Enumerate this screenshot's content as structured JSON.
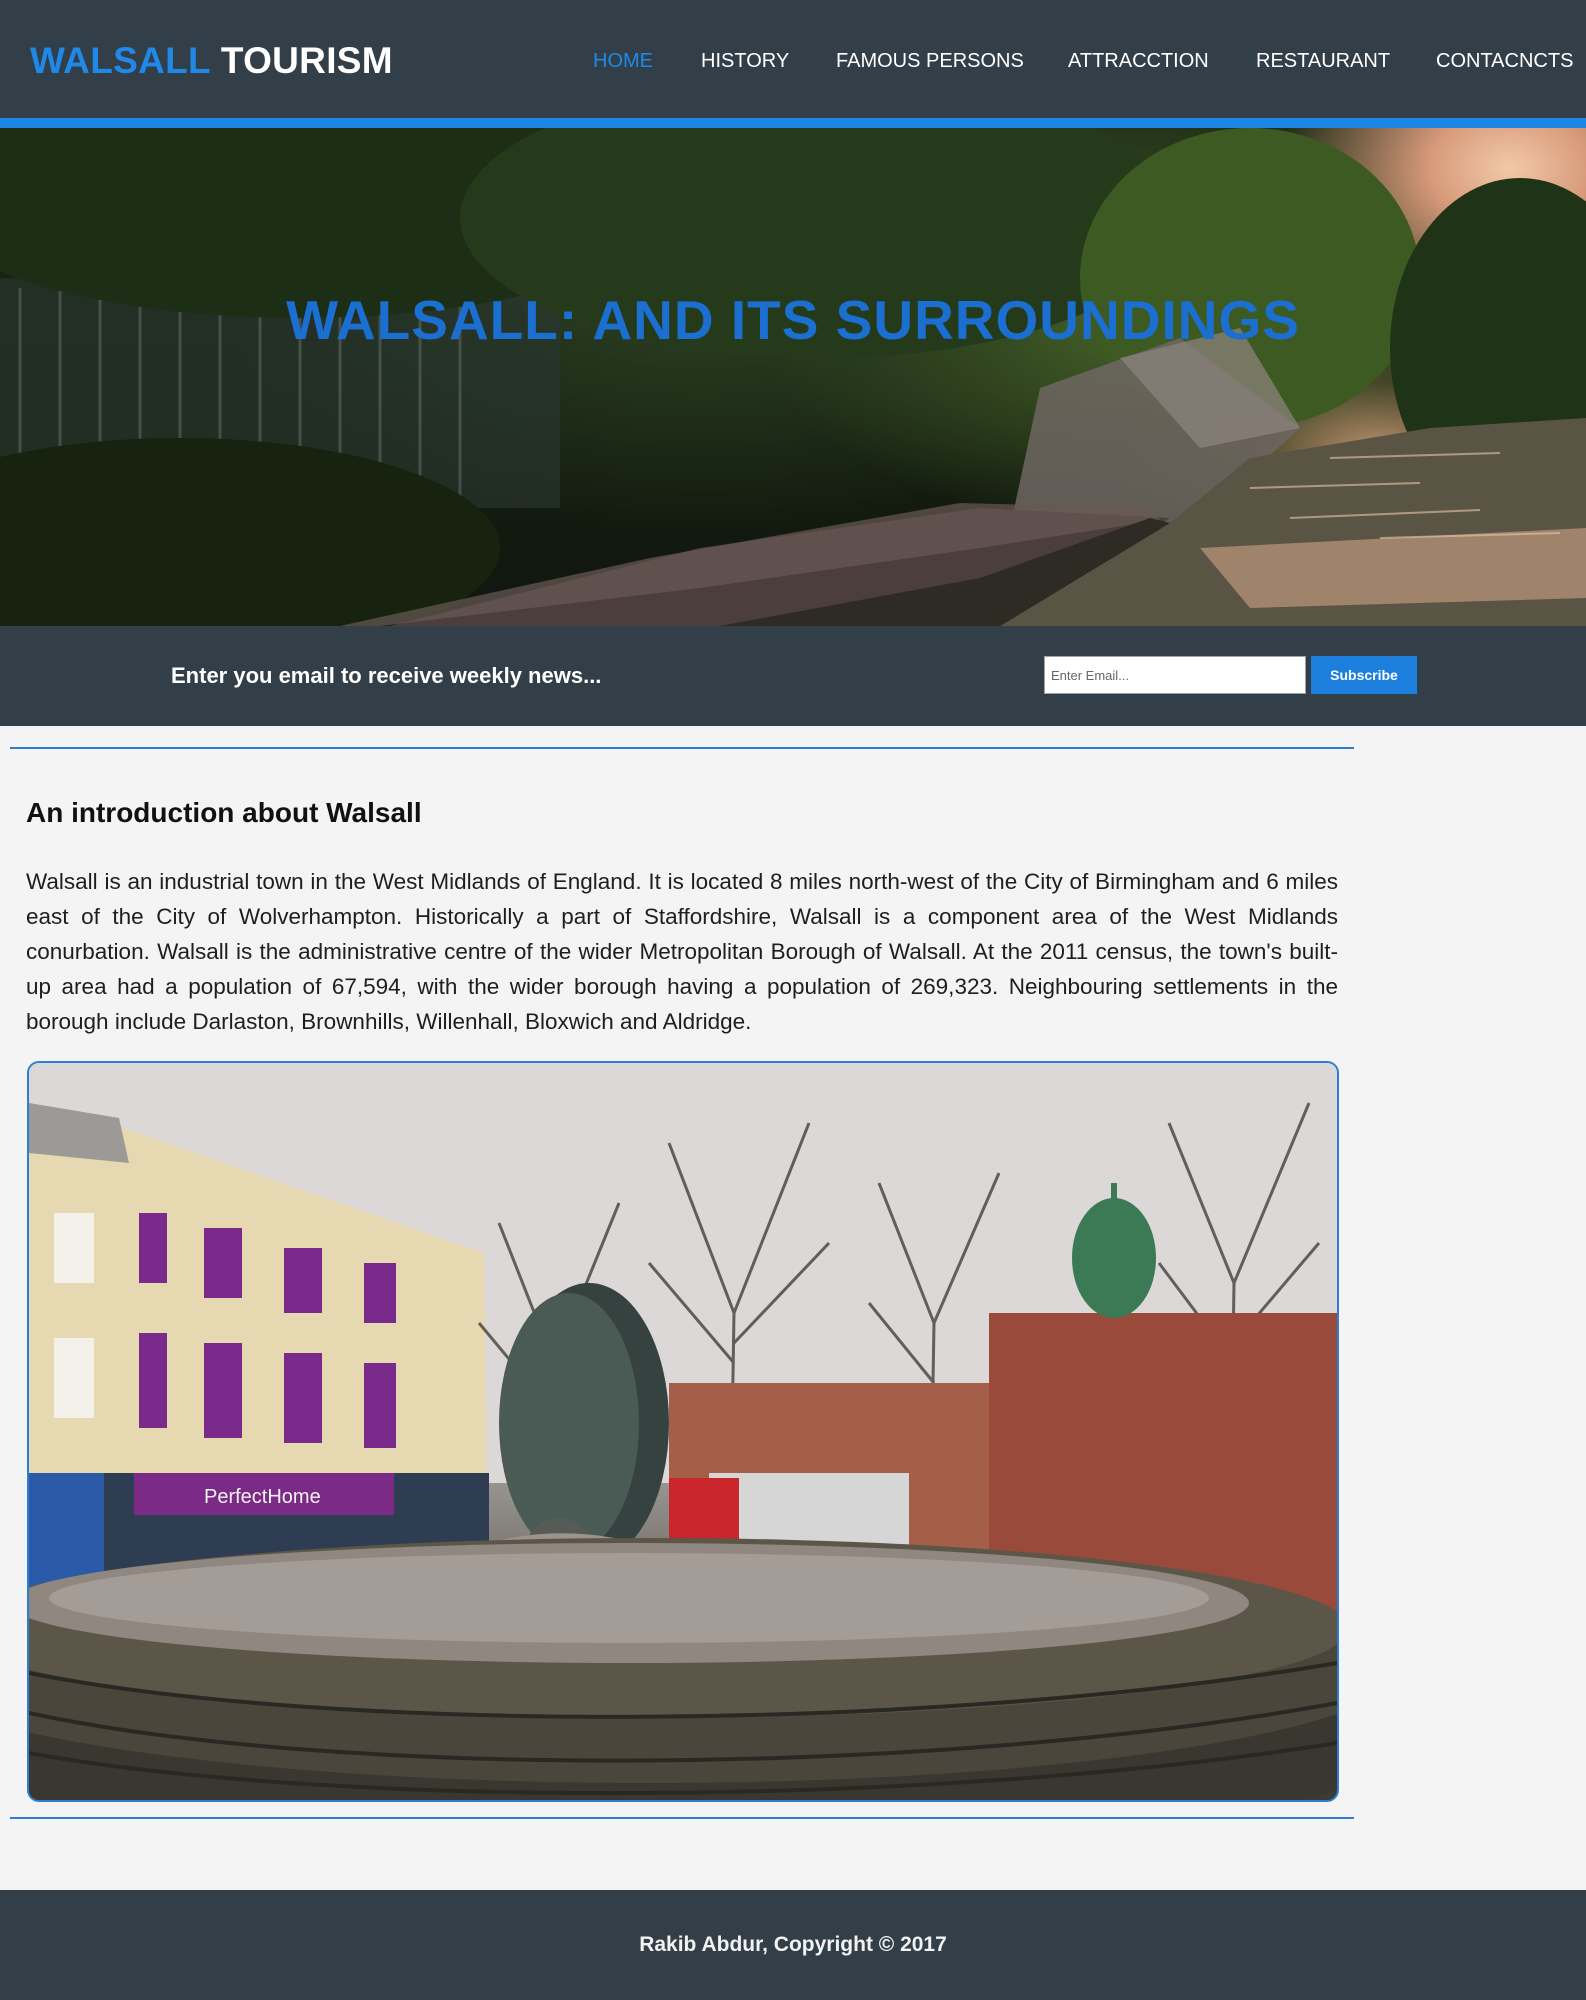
{
  "header": {
    "logo_accent": "WALSALL",
    "logo_rest": "TOURISM",
    "nav": [
      {
        "label": "HOME",
        "active": true
      },
      {
        "label": "HISTORY",
        "active": false
      },
      {
        "label": "FAMOUS PERSONS",
        "active": false
      },
      {
        "label": "ATTRACCTION",
        "active": false
      },
      {
        "label": "RESTAURANT",
        "active": false
      },
      {
        "label": "CONTACNCTS",
        "active": false
      }
    ]
  },
  "hero": {
    "title": "WALSALL: AND ITS SURROUNDINGS",
    "image": "canal-towpath-sunset-photo"
  },
  "newsletter": {
    "prompt": "Enter you email to receive weekly news...",
    "email_placeholder": "Enter Email...",
    "email_value": "",
    "subscribe_label": "Subscribe"
  },
  "main": {
    "heading": "An introduction about Walsall",
    "paragraph": "Walsall is an industrial town in the West Midlands of England. It is located 8 miles north-west of the City of Birmingham and 6 miles east of the City of Wolverhampton. Historically a part of Staffordshire, Walsall is a component area of the West Midlands conurbation. Walsall is the administrative centre of the wider Metropolitan Borough of Walsall. At the 2011 census, the town's built-up area had a population of 67,594, with the wider borough having a population of 269,323. Neighbouring settlements in the borough include Darlaston, Brownhills, Willenhall, Bloxwich and Aldridge.",
    "photo": "walsall-town-square-fountain-photo",
    "photo_shop_sign": "PerfectHome"
  },
  "footer": {
    "copyright": "Rakib Abdur, Copyright © 2017"
  },
  "colors": {
    "header_bg": "#323e48",
    "accent": "#1f88e9",
    "hero_title": "#1a6fd1",
    "page_bg": "#f4f4f4"
  }
}
